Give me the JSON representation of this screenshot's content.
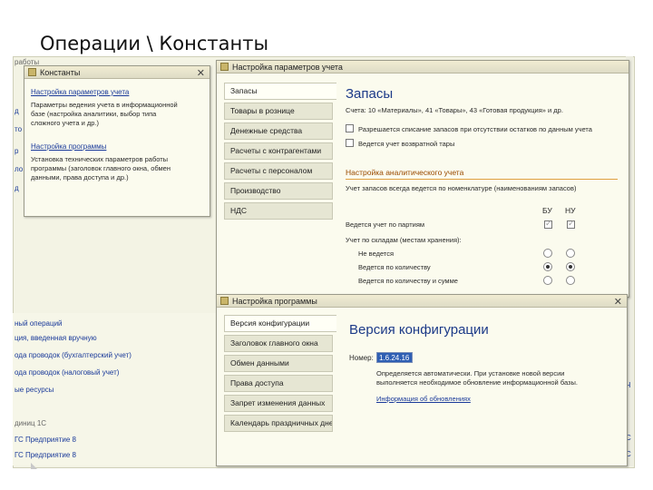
{
  "slide_title": "Операции \\ Константы",
  "background": {
    "top_label": "работы",
    "left_links": [
      "д",
      "то",
      "р",
      "ло",
      "д"
    ],
    "bottom_links": [
      "ный операций",
      "ция, введенная вручную",
      "ода проводок (бухгалтерский учет)",
      "ода проводок (налоговый учет)",
      "ые ресурсы",
      "диниц 1С",
      "ГС Предприятие 8"
    ],
    "right_marks": [
      "Ч",
      "С",
      "С"
    ]
  },
  "win_constants": {
    "title": "Константы",
    "close": "✕",
    "link1": "Настройка параметров учета",
    "desc1_lines": [
      "Параметры ведения учета в информационной",
      "базе (настройка аналитики, выбор типа",
      "сложного учета и др.)"
    ],
    "link2": "Настройка программы",
    "desc2_lines": [
      "Установка технических параметров работы",
      "программы (заголовок главного окна, обмен",
      "данными, права доступа и др.)"
    ]
  },
  "win_params": {
    "title": "Настройка параметров учета",
    "tabs": [
      "Запасы",
      "Товары в рознице",
      "Денежные средства",
      "Расчеты с контрагентами",
      "Расчеты с персоналом",
      "Производство",
      "НДС"
    ],
    "heading": "Запасы",
    "accounts_line": "Счета: 10 «Материалы», 41 «Товары», 43 «Готовая продукция» и др.",
    "cb1_label": "Разрешается списание запасов при отсутствии остатков по данным учета",
    "cb2_label": "Ведется учет возвратной тары",
    "section": "Настройка аналитического учета",
    "nomen_line": "Учет запасов всегда ведется по номенклатуре (наименованиям запасов)",
    "col_bu": "БУ",
    "col_nu": "НУ",
    "row_batches": "Ведется учет по партиям",
    "row_warehouses": "Учет по складам (местам хранения):",
    "opt1": "Не ведется",
    "opt2": "Ведется по количеству",
    "opt3": "Ведется по количеству и сумме"
  },
  "win_program": {
    "title": "Настройка программы",
    "close": "✕",
    "tabs": [
      "Версия конфигурации",
      "Заголовок главного окна",
      "Обмен данными",
      "Права доступа",
      "Запрет изменения данных",
      "Календарь праздничных дней"
    ],
    "heading": "Версия конфигурации",
    "number_label": "Номер:",
    "number_value": "1.6.24.16",
    "note_lines": [
      "Определяется автоматически. При установке новой версии",
      "выполняется необходимое обновление информационной базы."
    ],
    "link": "Информация об обновлениях"
  }
}
